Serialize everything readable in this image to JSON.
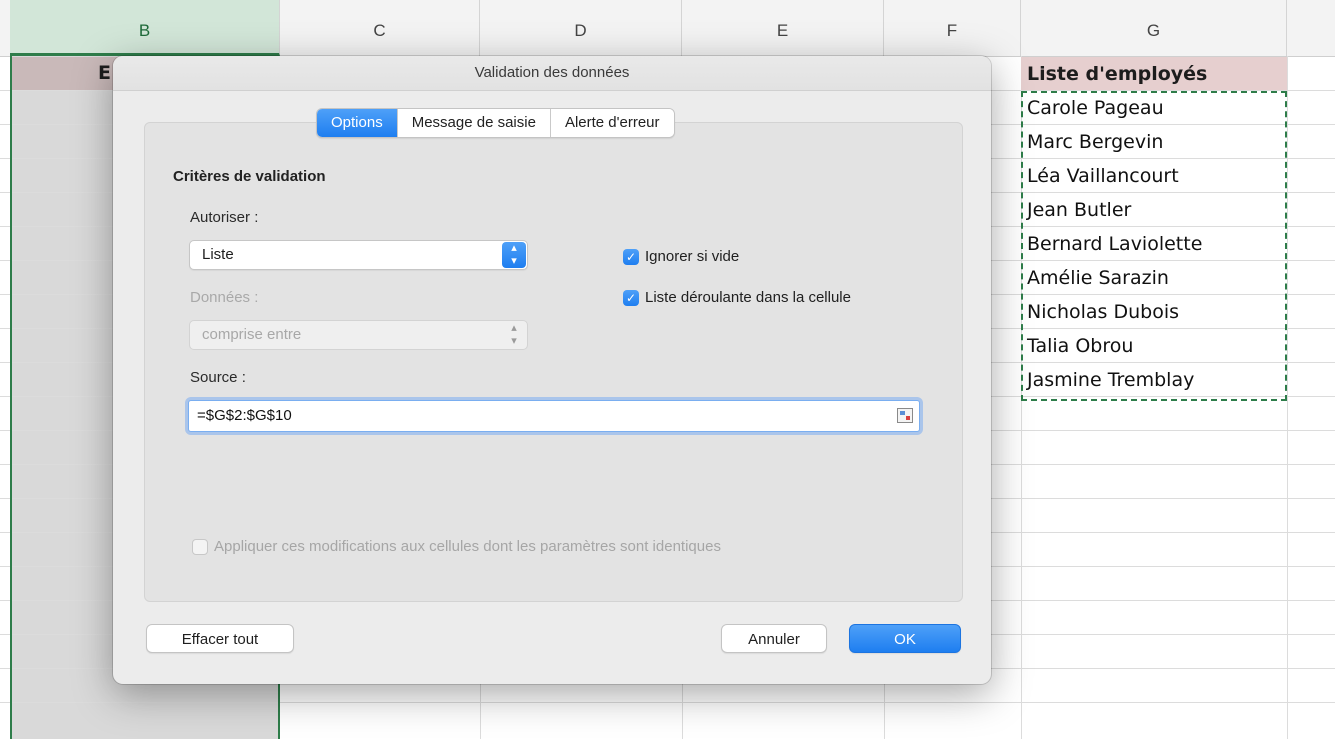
{
  "spreadsheet": {
    "columns": [
      "B",
      "C",
      "D",
      "E",
      "F",
      "G"
    ],
    "selected_column": "B",
    "b1_partial": "E",
    "g_header": "Liste d'employés",
    "employees": [
      "Carole Pageau",
      "Marc Bergevin",
      "Léa Vaillancourt",
      "Jean Butler",
      "Bernard Laviolette",
      "Amélie Sarazin",
      "Nicholas Dubois",
      "Talia Obrou",
      "Jasmine Tremblay"
    ]
  },
  "dialog": {
    "title": "Validation des données",
    "tabs": [
      {
        "label": "Options",
        "active": true
      },
      {
        "label": "Message de saisie",
        "active": false
      },
      {
        "label": "Alerte d'erreur",
        "active": false
      }
    ],
    "criteria_title": "Critères de validation",
    "allow_label": "Autoriser :",
    "allow_value": "Liste",
    "data_label": "Données :",
    "data_value": "comprise entre",
    "ignore_blank": {
      "label": "Ignorer si vide",
      "checked": true
    },
    "in_cell_dropdown": {
      "label": "Liste déroulante dans la cellule",
      "checked": true
    },
    "source_label": "Source :",
    "source_value": "=$G$2:$G$10",
    "apply_all": {
      "label": "Appliquer ces modifications aux cellules dont les paramètres sont identiques",
      "checked": false
    },
    "clear_all_label": "Effacer tout",
    "cancel_label": "Annuler",
    "ok_label": "OK"
  },
  "colors": {
    "accent": "#1e7ef0",
    "selected_column": "#d2e6d8",
    "marquee": "#2e7d4a",
    "header_fill": "#e6cfcf"
  }
}
